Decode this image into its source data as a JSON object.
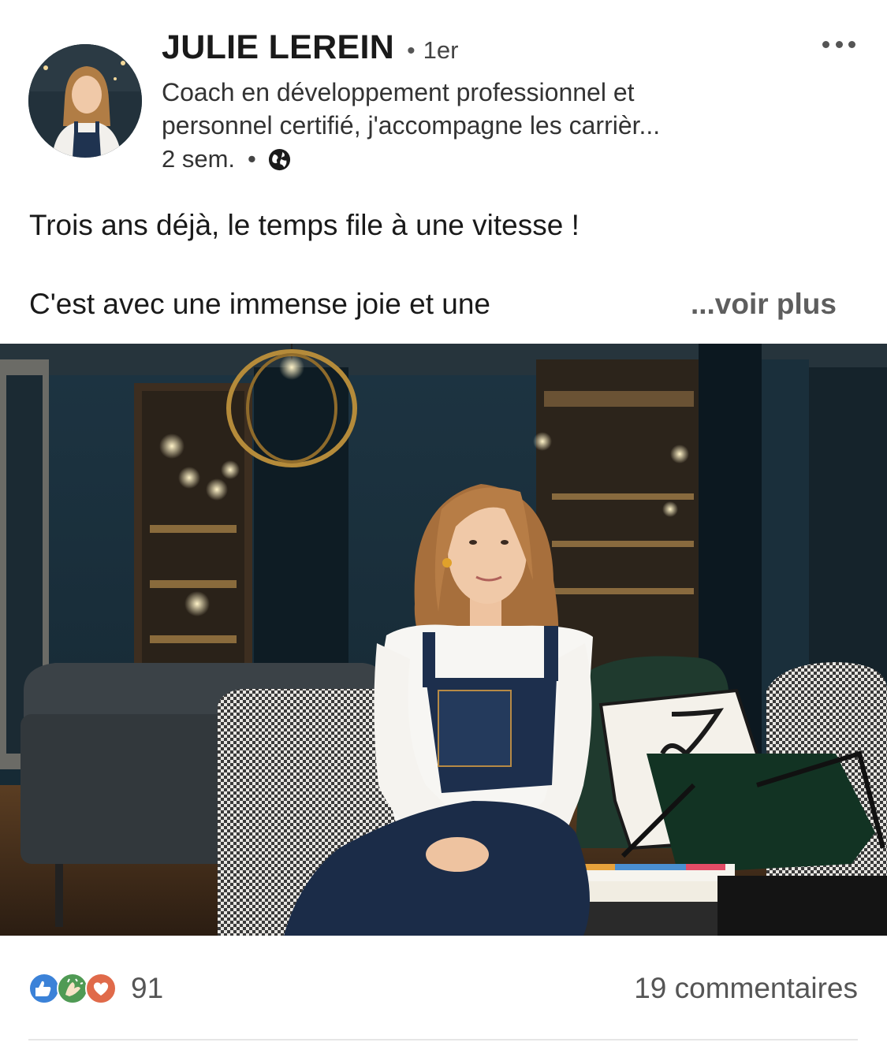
{
  "post": {
    "author": {
      "name": "JULIE LEREIN",
      "degree": "1er",
      "headline_line1": "Coach en développement professionnel et",
      "headline_line2": "personnel certifié, j'accompagne les carrièr...",
      "time": "2 sem.",
      "visibility_icon": "globe-icon"
    },
    "text": {
      "line1": "Trois ans déjà, le temps file à une vitesse !",
      "line2": "C'est avec une immense joie et une",
      "see_more": "...voir plus"
    },
    "image": {
      "description_icon": "photo-image"
    },
    "social": {
      "reactions": [
        "like-icon",
        "celebrate-icon",
        "love-icon"
      ],
      "reaction_count": "91",
      "comments": "19 commentaires"
    }
  },
  "colors": {
    "like": "#3b82d8",
    "celebrate": "#4f9a54",
    "love": "#e06a4a",
    "muted_text": "#5e5e5e"
  }
}
